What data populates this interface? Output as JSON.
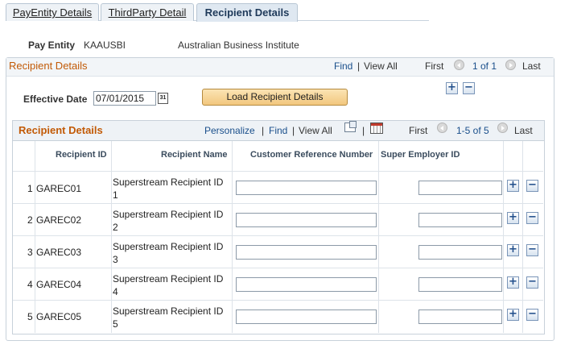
{
  "tabs": [
    {
      "label": "PayEntity Details",
      "active": false
    },
    {
      "label": "ThirdParty Detail",
      "active": false
    },
    {
      "label": "Recipient Details",
      "active": true
    }
  ],
  "header": {
    "pay_entity_label": "Pay Entity",
    "pay_entity_code": "KAAUSBI",
    "pay_entity_name": "Australian Business Institute"
  },
  "recipient_group": {
    "title": "Recipient Details",
    "find": "Find",
    "sep": "|",
    "view_all": "View All",
    "first": "First",
    "range": "1 of 1",
    "last": "Last",
    "effective_date_label": "Effective Date",
    "effective_date_value": "07/01/2015",
    "load_button": "Load Recipient Details"
  },
  "grid": {
    "title": "Recipient Details",
    "personalize": "Personalize",
    "find": "Find",
    "view_all": "View All",
    "sep": "|",
    "first": "First",
    "range": "1-5 of 5",
    "last": "Last",
    "columns": [
      "Recipient ID",
      "Recipient Name",
      "Customer Reference Number",
      "Super Employer ID"
    ],
    "rows": [
      {
        "num": "1",
        "id": "GAREC01",
        "name_line1": "Superstream Recipient ID",
        "name_line2": "1",
        "crn": "",
        "seid": ""
      },
      {
        "num": "2",
        "id": "GAREC02",
        "name_line1": "Superstream Recipient ID",
        "name_line2": "2",
        "crn": "",
        "seid": ""
      },
      {
        "num": "3",
        "id": "GAREC03",
        "name_line1": "Superstream Recipient ID",
        "name_line2": "3",
        "crn": "",
        "seid": ""
      },
      {
        "num": "4",
        "id": "GAREC04",
        "name_line1": "Superstream Recipient ID",
        "name_line2": "4",
        "crn": "",
        "seid": ""
      },
      {
        "num": "5",
        "id": "GAREC05",
        "name_line1": "Superstream Recipient ID",
        "name_line2": "5",
        "crn": "",
        "seid": ""
      }
    ]
  },
  "icons": {
    "add": "+",
    "delete": "−",
    "calendar": "31"
  },
  "colors": {
    "section_title": "#c25a06",
    "link": "#1a4f8b",
    "button_fill": "#f2c77e"
  }
}
